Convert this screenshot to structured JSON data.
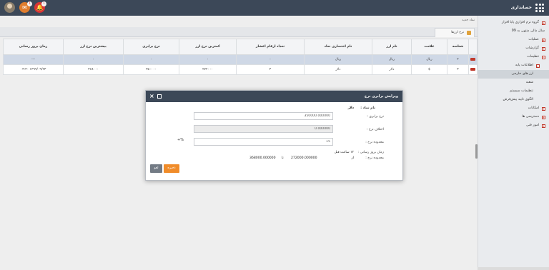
{
  "topbar": {
    "app_title": "حسابداری",
    "notif_count_1": "1",
    "notif_count_2": "1"
  },
  "sidebar": {
    "items": [
      {
        "label": "گروه نرم افزاری پایا افزار",
        "plus": true
      },
      {
        "label": "سال مالی منتهی به 99",
        "plus": false
      },
      {
        "label": "عملیات",
        "plus": true
      },
      {
        "label": "گزارشات",
        "plus": true
      },
      {
        "label": "تنظیمات",
        "plus": true
      },
      {
        "label": "اطلاعات پایه",
        "plus": true,
        "sub": true
      },
      {
        "label": "ارز های خارجی",
        "active": true,
        "sub": true
      },
      {
        "label": "شعبه",
        "sub": true
      },
      {
        "label": "تنظیمات سیستم",
        "sub": true
      },
      {
        "label": "الگوی تایید پیش‌فرض",
        "sub": true
      },
      {
        "label": "امکانات",
        "plus": true
      },
      {
        "label": "دسترسی ها",
        "plus": true
      },
      {
        "label": "امور فنی",
        "plus": true
      }
    ]
  },
  "main": {
    "breadcrumb": "نماد جدید",
    "tab_label": "نرخ ارزها",
    "columns": [
      "شناسه",
      "علامت",
      "نام ارز",
      "نام اختصاری نماد",
      "تعداد ارقام اعشار",
      "کمترین نرخ ارز",
      "نرخ برابری",
      "بیشترین نرخ ارز",
      "زمان بروز رسانی"
    ],
    "rows": [
      {
        "num": "۲",
        "id": "",
        "symbol": "ریال",
        "name": "ریال",
        "short": "ریال",
        "decimals": "۰",
        "min": "۰",
        "rate": "۰",
        "max": "۰",
        "updated": "---"
      },
      {
        "num": "۳",
        "id": "",
        "symbol": "$",
        "name": "دلار",
        "short": "دلار",
        "decimals": "۳",
        "min": "۲۷۲۰۰۰",
        "rate": "۳۵۰۰۰۰",
        "max": "۳۶۸۰۰۰",
        "updated": "۱۳۹۹/۰۹/۲۳ ۰۳:۳۰"
      }
    ]
  },
  "dialog": {
    "title": "ویرایش برابری نرخ",
    "currency_name_label": "نام نماد :",
    "currency_name_value": "دلار",
    "rate_label": "نرخ برابری :",
    "rate_value": "350000.000000",
    "diff_label": "اختلاف نرخ :",
    "diff_value": "0.000000",
    "range_label": "محدوده نرخ :",
    "range_value": "15",
    "plus_minus": "+%",
    "update_label": "زمان بروز رسانی :",
    "update_value": "۱۲ ساعت قبل",
    "range2_label": "محدوده نرخ :",
    "range_from_label": "از",
    "range_from": "272000.000000",
    "range_to_label": "تا",
    "range_to": "368000.000000",
    "save_label": "ذخیره",
    "cancel_label": "لغو"
  }
}
